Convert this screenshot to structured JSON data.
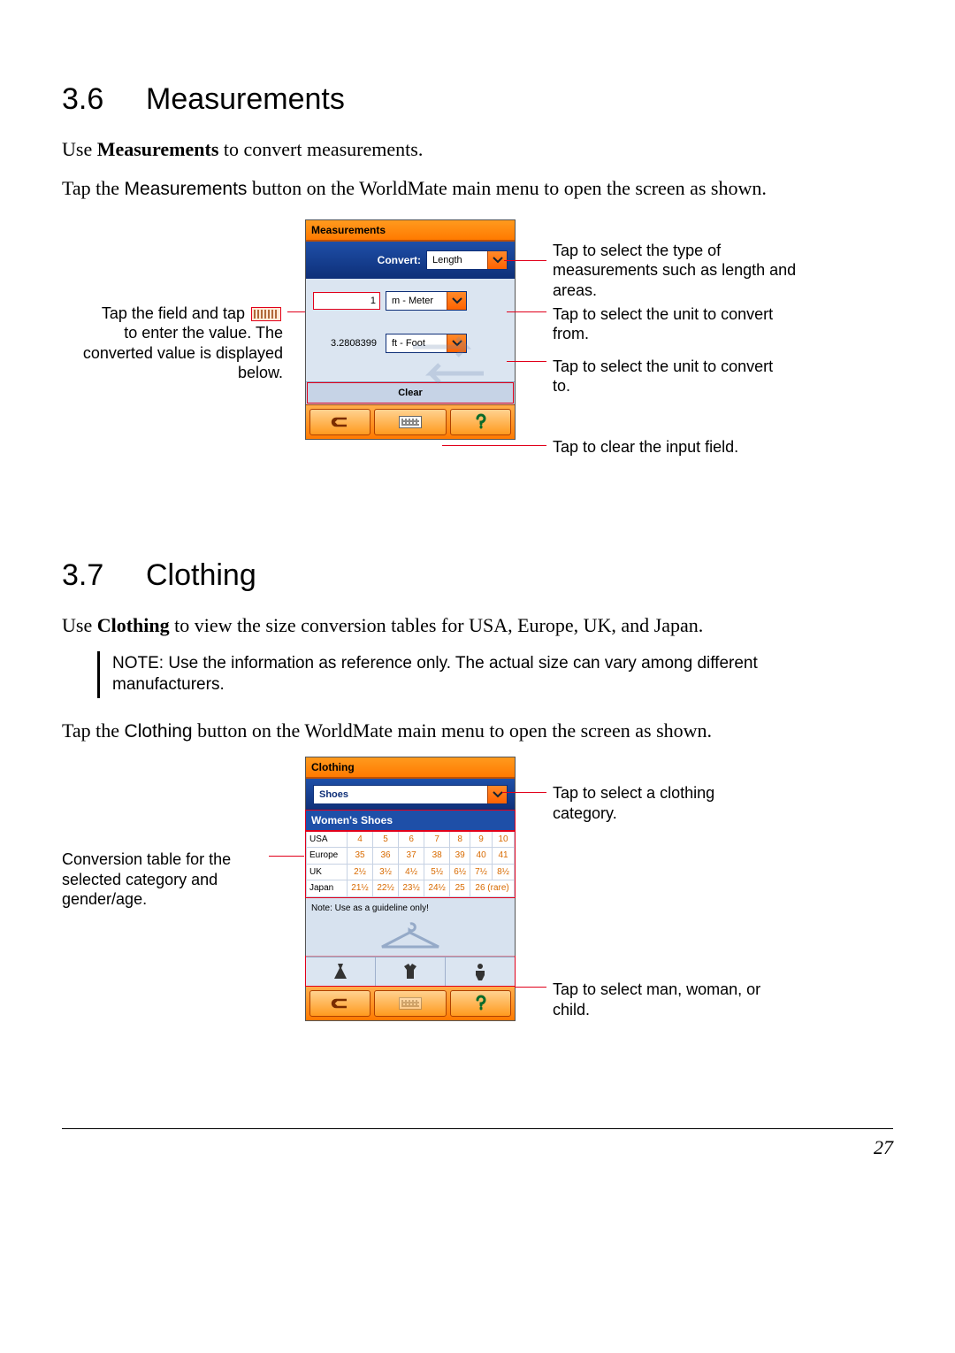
{
  "section36": {
    "number": "3.6",
    "title": "Measurements",
    "intro_pre": "Use ",
    "intro_bold": "Measurements",
    "intro_post": " to convert measurements.",
    "para2_pre": "Tap the ",
    "para2_btn": "Measurements",
    "para2_post": " button on the WorldMate main menu to open the screen as shown."
  },
  "fig1": {
    "titlebar": "Measurements",
    "convert_label": "Convert:",
    "convert_value": "Length",
    "input_value": "1",
    "from_unit": "m - Meter",
    "output_value": "3.2808399",
    "to_unit": "ft - Foot",
    "clear_label": "Clear",
    "callouts": {
      "left1a": "Tap the field and tap",
      "left1b": "to enter the value. The converted value is displayed below.",
      "right1": "Tap to select the type of measurements such as length and areas.",
      "right2": "Tap to select the unit to convert from.",
      "right3": "Tap to select the unit to convert to.",
      "right4": "Tap to clear the input field."
    }
  },
  "section37": {
    "number": "3.7",
    "title": "Clothing",
    "intro_pre": "Use ",
    "intro_bold": "Clothing",
    "intro_post": " to view the size conversion tables for USA, Europe, UK, and Japan.",
    "note_label": "NOTE: ",
    "note_text": "Use the information as reference only. The actual size can vary among different manufacturers.",
    "para2_pre": "Tap the ",
    "para2_btn": "Clothing",
    "para2_post": " button on the WorldMate main menu to open the screen as shown."
  },
  "fig2": {
    "titlebar": "Clothing",
    "dropdown_value": "Shoes",
    "section_label": "Women's Shoes",
    "rows": [
      {
        "region": "USA",
        "vals": [
          "4",
          "5",
          "6",
          "7",
          "8",
          "9",
          "10"
        ]
      },
      {
        "region": "Europe",
        "vals": [
          "35",
          "36",
          "37",
          "38",
          "39",
          "40",
          "41"
        ]
      },
      {
        "region": "UK",
        "vals": [
          "2½",
          "3½",
          "4½",
          "5½",
          "6½",
          "7½",
          "8½"
        ]
      },
      {
        "region": "Japan",
        "vals": [
          "21½",
          "22½",
          "23½",
          "24½",
          "25",
          "26 (rare)"
        ]
      }
    ],
    "note_line": "Note: Use as a guideline only!",
    "callouts": {
      "right1": "Tap to select a clothing category.",
      "left1": "Conversion table for the selected category and gender/age.",
      "right2": "Tap to select man, woman, or child."
    }
  },
  "page_number": "27"
}
